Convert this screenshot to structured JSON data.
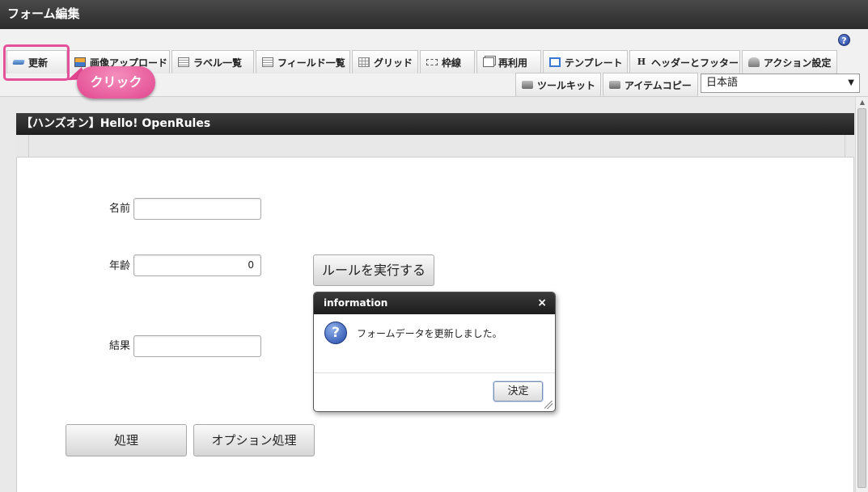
{
  "window": {
    "title": "フォーム編集"
  },
  "toolbar": {
    "row1": [
      {
        "label": "更新",
        "icon": "refresh-icon"
      },
      {
        "label": "画像アップロード",
        "icon": "image-upload-icon"
      },
      {
        "label": "ラベル一覧",
        "icon": "list-icon"
      },
      {
        "label": "フィールド一覧",
        "icon": "list-icon"
      },
      {
        "label": "グリッド",
        "icon": "grid-icon"
      },
      {
        "label": "枠線",
        "icon": "border-icon"
      },
      {
        "label": "再利用",
        "icon": "copy-icon"
      },
      {
        "label": "テンプレート",
        "icon": "template-icon"
      },
      {
        "label": "ヘッダーとフッター",
        "icon": "header-icon"
      },
      {
        "label": "アクション設定",
        "icon": "action-icon"
      }
    ],
    "row2": [
      {
        "label": "ツールキット",
        "icon": "toolkit-icon"
      },
      {
        "label": "アイテムコピー",
        "icon": "toolkit-icon"
      }
    ],
    "help_glyph": "?",
    "language": {
      "selected": "日本語"
    }
  },
  "annotation": {
    "callout_text": "クリック"
  },
  "form": {
    "title": "【ハンズオン】Hello! OpenRules",
    "name_label": "名前",
    "name_value": "",
    "age_label": "年齢",
    "age_value": "0",
    "result_label": "結果",
    "result_value": "",
    "run_rules_button": "ルールを実行する",
    "process_button": "処理",
    "option_process_button": "オプション処理"
  },
  "dialog": {
    "title": "information",
    "close_glyph": "×",
    "icon_glyph": "?",
    "message": "フォームデータを更新しました。",
    "ok_button": "決定"
  },
  "colors": {
    "highlight": "#e5509b",
    "header_dark": "#2b2b2b"
  }
}
